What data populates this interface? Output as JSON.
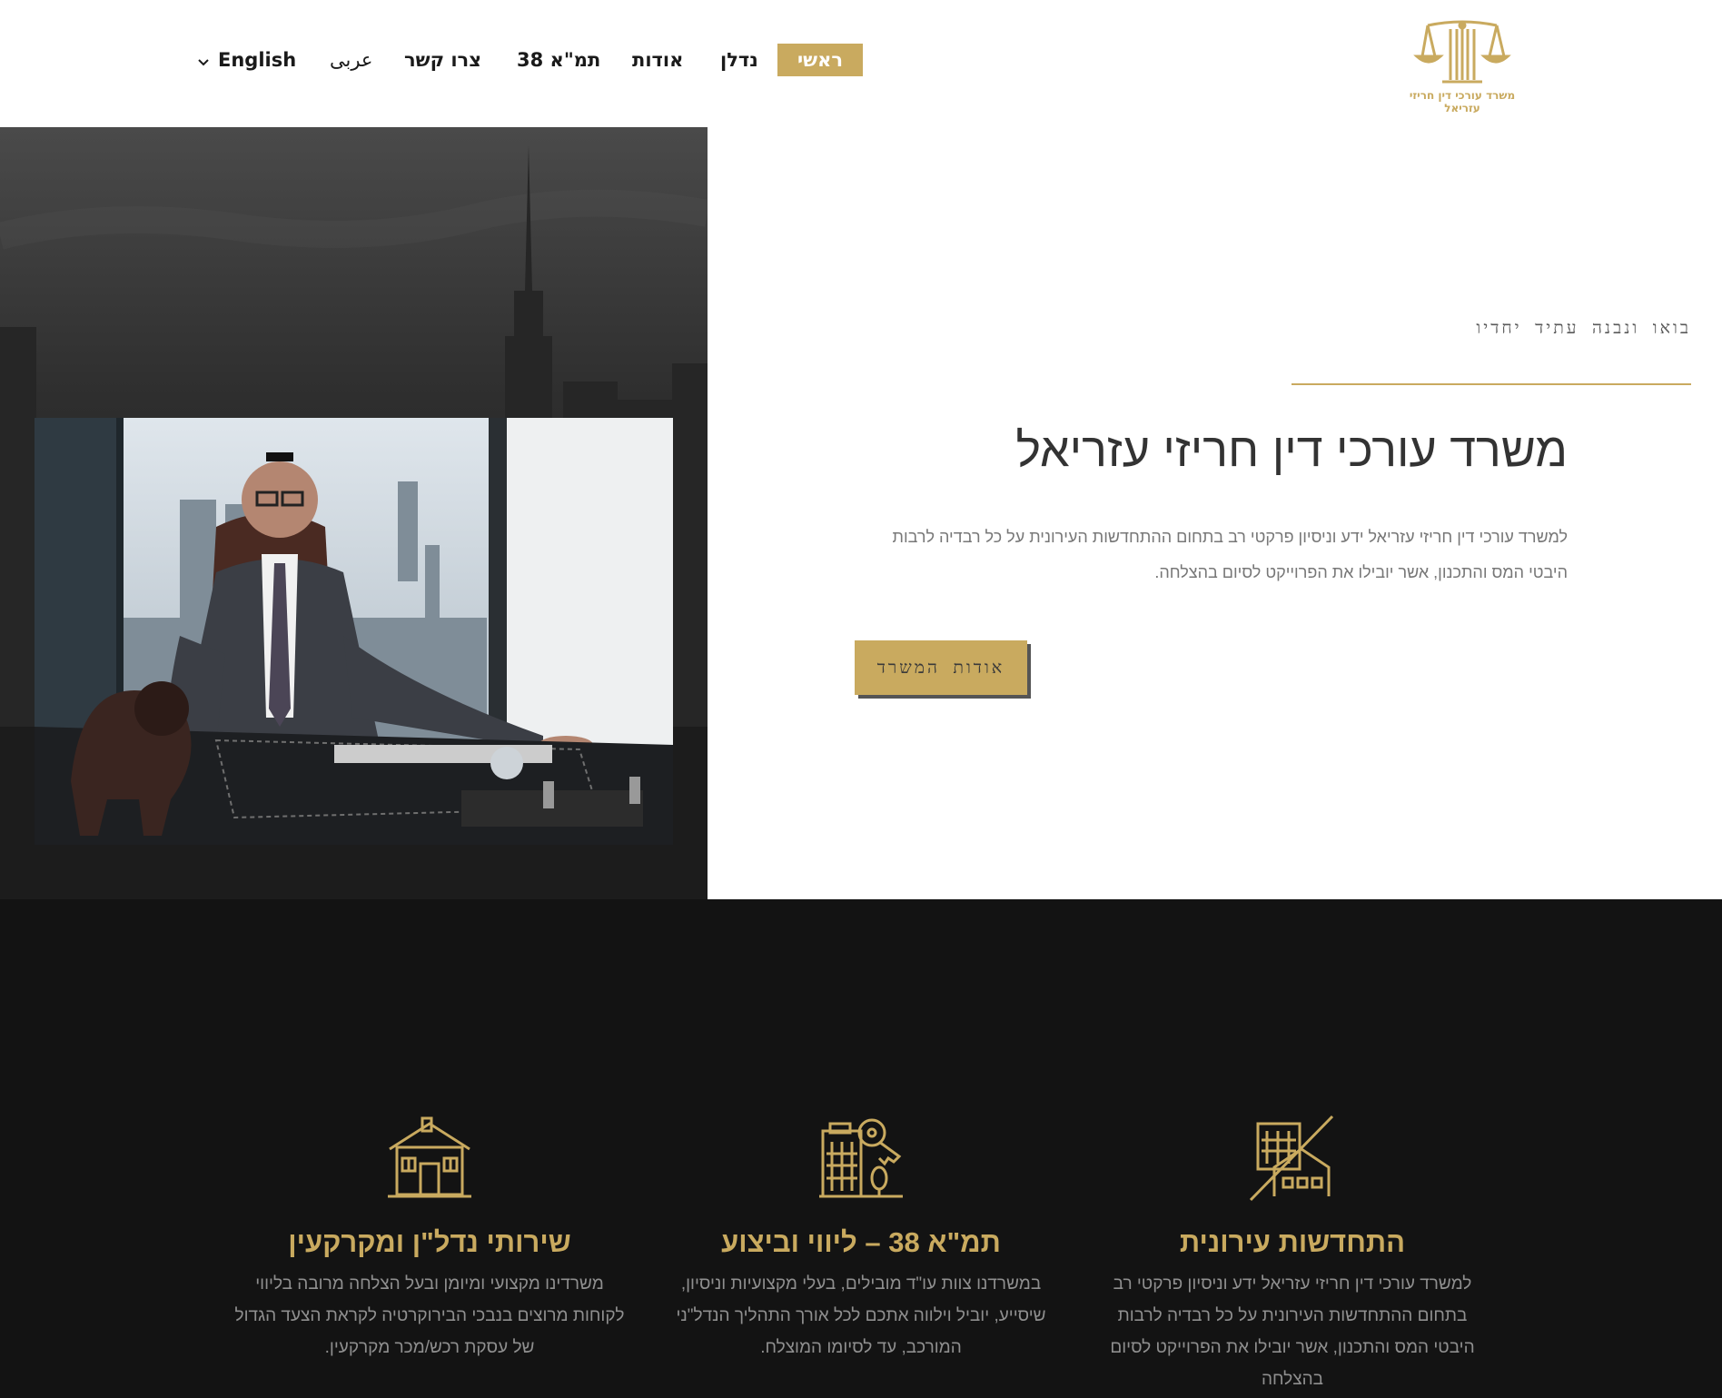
{
  "header": {
    "nav": [
      {
        "label": "ראשי"
      },
      {
        "label": "נדלן"
      },
      {
        "label": "אודות"
      },
      {
        "label": "תמ\"א 38"
      },
      {
        "label": "צרו קשר"
      },
      {
        "label": "عربى"
      },
      {
        "label": "English"
      }
    ],
    "logo_text": "משרד עורכי דין חריזי עזריאל"
  },
  "hero": {
    "tagline": "בואו ונבנה עתיד יחדיו",
    "title": "משרד עורכי דין חריזי עזריאל",
    "description": "למשרד עורכי דין חריזי עזריאל ידע וניסיון פרקטי רב בתחום ההתחדשות העירונית על כל רבדיה לרבות היבטי המס והתכנון, אשר יובילו את הפרוייקט לסיום בהצלחה.",
    "button": "אודות המשרד"
  },
  "services": [
    {
      "icon": "house-icon",
      "title": "שירותי נדל\"ן ומקרקעין",
      "text": "משרדינו מקצועי ומיומן ובעל הצלחה מרובה בליווי לקוחות מרוצים בנבכי הבירוקרטיה לקראת הצעד הגדול של עסקת רכש/מכר מקרקעין."
    },
    {
      "icon": "building-key-icon",
      "title": "תמ\"א 38 – ליווי וביצוע",
      "text": "במשרדנו צוות עו\"ד מובילים, בעלי מקצועיות וניסיון, שיסייע, יוביל וילווה אתכם לכל אורך התהליך הנדל\"ני המורכב, עד לסיומו המוצלח."
    },
    {
      "icon": "urban-renewal-icon",
      "title": "התחדשות עירונית",
      "text": "למשרד עורכי דין חריזי עזריאל ידע וניסיון פרקטי רב בתחום ההתחדשות העירונית על כל רבדיה לרבות היבטי המס והתכנון, אשר יובילו את הפרוייקט לסיום בהצלחה"
    }
  ],
  "colors": {
    "gold": "#c9aa5f",
    "dark": "#131313"
  }
}
